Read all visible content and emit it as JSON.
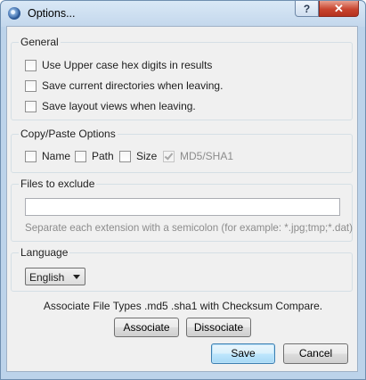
{
  "window": {
    "title": "Options..."
  },
  "titlebar": {
    "help_label": "?",
    "close_label": "✕"
  },
  "general": {
    "label": "General",
    "options": [
      {
        "label": "Use Upper case hex digits in results",
        "checked": false
      },
      {
        "label": "Save current directories when leaving.",
        "checked": false
      },
      {
        "label": "Save layout views when leaving.",
        "checked": false
      }
    ]
  },
  "copy_paste": {
    "label": "Copy/Paste Options",
    "options": [
      {
        "label": "Name",
        "checked": false,
        "enabled": true
      },
      {
        "label": "Path",
        "checked": false,
        "enabled": true
      },
      {
        "label": "Size",
        "checked": false,
        "enabled": true
      },
      {
        "label": "MD5/SHA1",
        "checked": true,
        "enabled": false
      }
    ]
  },
  "exclude": {
    "label": "Files to exclude",
    "value": "",
    "hint": "Separate each extension with a semicolon (for example: *.jpg;tmp;*.dat)"
  },
  "language": {
    "label": "Language",
    "selected": "English"
  },
  "association": {
    "text": "Associate File Types .md5 .sha1 with Checksum Compare.",
    "associate_label": "Associate",
    "dissociate_label": "Dissociate"
  },
  "footer": {
    "save_label": "Save",
    "cancel_label": "Cancel"
  }
}
